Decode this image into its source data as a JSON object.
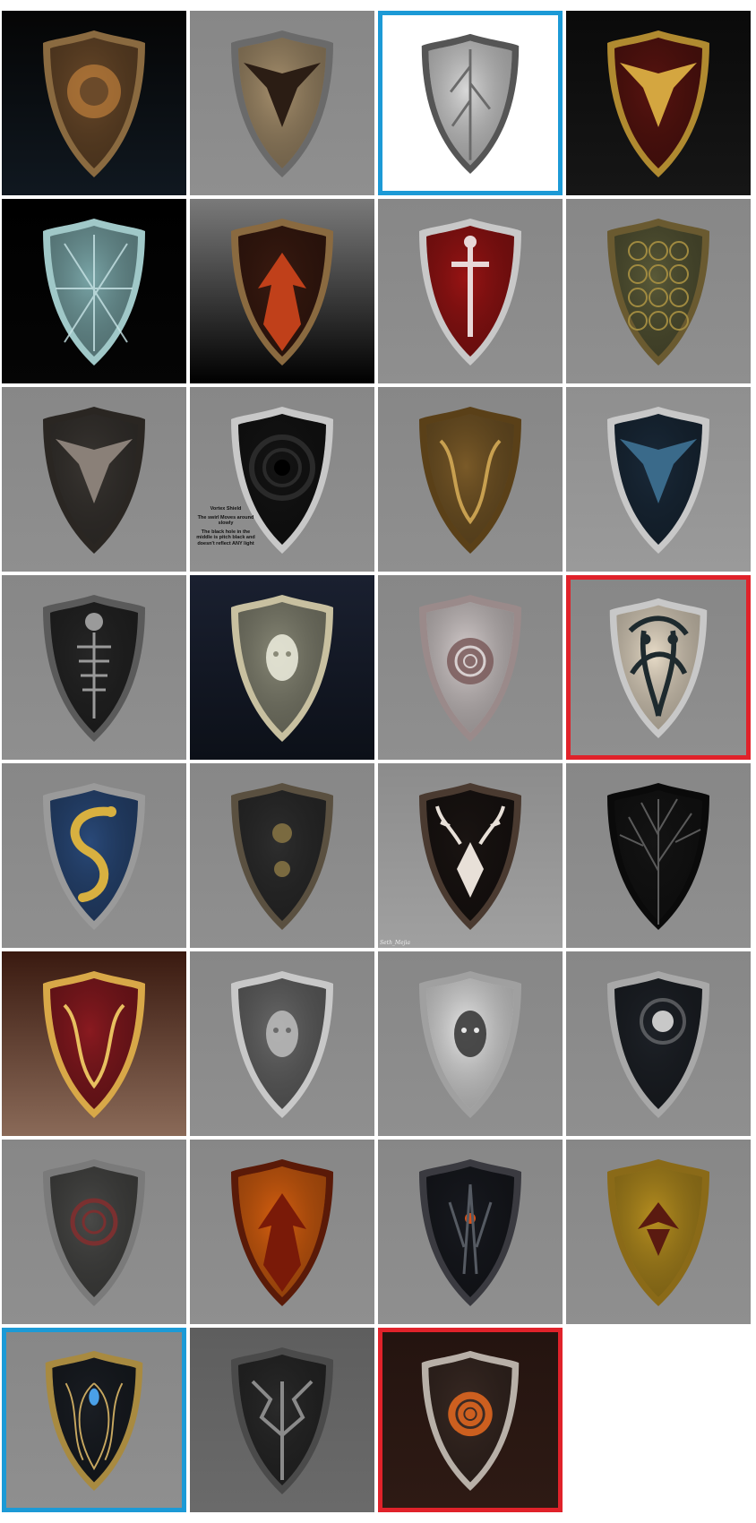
{
  "grid": {
    "tiles": [
      {
        "name": "lion-shield",
        "bg": "#050505",
        "bg2": "#101820",
        "face": "#6b4a2a",
        "accent": "#d08a40",
        "rim": "#8a6a40",
        "motif": "lion-icon",
        "selected": null
      },
      {
        "name": "dragon-sigil-shield",
        "bg": "#878787",
        "bg2": "#8f8f8f",
        "face": "#a8916e",
        "accent": "#2b1d14",
        "rim": "#6a6a6a",
        "motif": "dragon-icon",
        "selected": null
      },
      {
        "name": "white-feather-shield",
        "bg": "#ffffff",
        "bg2": "#ffffff",
        "face": "#d8d8d8",
        "accent": "#6a6a6a",
        "rim": "#555555",
        "motif": "feather-icon",
        "selected": "blue"
      },
      {
        "name": "golden-dragon-shield",
        "bg": "#0a0a0a",
        "bg2": "#161616",
        "face": "#5a1410",
        "accent": "#d4a640",
        "rim": "#b08a30",
        "motif": "dragon-icon",
        "selected": null
      },
      {
        "name": "frost-shield",
        "bg": "#000000",
        "bg2": "#050505",
        "face": "#7aa6a8",
        "accent": "#c8e4e6",
        "rim": "#a0c8c8",
        "motif": "frost-icon",
        "selected": null
      },
      {
        "name": "fire-scale-shield",
        "bg": "#7a7a7a",
        "bg2": "#000000",
        "face": "#3a1a10",
        "accent": "#c0401a",
        "rim": "#8a6a40",
        "motif": "flame-icon",
        "selected": null
      },
      {
        "name": "red-sword-shield",
        "bg": "#878787",
        "bg2": "#8f8f8f",
        "face": "#9a1414",
        "accent": "#e8d8d8",
        "rim": "#c8c8c8",
        "motif": "sword-icon",
        "selected": null
      },
      {
        "name": "turtle-shell-shield",
        "bg": "#878787",
        "bg2": "#8f8f8f",
        "face": "#5a5a38",
        "accent": "#a08a40",
        "rim": "#6a5a30",
        "motif": "scale-icon",
        "selected": null
      },
      {
        "name": "bird-mask-shield",
        "bg": "#878787",
        "bg2": "#8f8f8f",
        "face": "#3a3632",
        "accent": "#8a8078",
        "rim": "#2a2622",
        "motif": "bird-icon",
        "selected": null
      },
      {
        "name": "vortex-shield",
        "bg": "#878787",
        "bg2": "#8f8f8f",
        "face": "#141414",
        "accent": "#2a2a2a",
        "rim": "#c8c8c8",
        "motif": "vortex-icon",
        "selected": null,
        "caption_title": "Vortex Shield",
        "caption_lines": [
          "The swirl Moves around slowly",
          "The black hole in the middle is pitch black and doesn't reflect ANY light"
        ]
      },
      {
        "name": "bronze-ornate-shield",
        "bg": "#878787",
        "bg2": "#8f8f8f",
        "face": "#7a5a28",
        "accent": "#c8a050",
        "rim": "#5a4018",
        "motif": "ornament-icon",
        "selected": null
      },
      {
        "name": "raven-blue-shield",
        "bg": "#8f8f8f",
        "bg2": "#9a9a9a",
        "face": "#1a2a3a",
        "accent": "#3a6a8a",
        "rim": "#c8c8c8",
        "motif": "raven-icon",
        "selected": null
      },
      {
        "name": "skeleton-shield",
        "bg": "#878787",
        "bg2": "#8f8f8f",
        "face": "#262626",
        "accent": "#9a9a9a",
        "rim": "#5a5a5a",
        "motif": "skull-icon",
        "selected": null
      },
      {
        "name": "silver-face-shield",
        "bg": "#1a2030",
        "bg2": "#0c1018",
        "face": "#8a8a78",
        "accent": "#e8e8d8",
        "rim": "#c8c0a0",
        "motif": "face-icon",
        "selected": null
      },
      {
        "name": "white-rose-shield",
        "bg": "#878787",
        "bg2": "#8f8f8f",
        "face": "#d8d0d0",
        "accent": "#7a5a5a",
        "rim": "#9a8a8a",
        "motif": "rose-icon",
        "selected": null
      },
      {
        "name": "celtic-knot-shield",
        "bg": "#878787",
        "bg2": "#8f8f8f",
        "face": "#e8dcc8",
        "accent": "#1e2a2e",
        "rim": "#c8c8c8",
        "motif": "knot-icon",
        "selected": "red"
      },
      {
        "name": "golden-serpent-shield",
        "bg": "#878787",
        "bg2": "#8f8f8f",
        "face": "#2a4a7a",
        "accent": "#d8b040",
        "rim": "#9a9a9a",
        "motif": "serpent-icon",
        "selected": null
      },
      {
        "name": "twin-sun-shield",
        "bg": "#878787",
        "bg2": "#8f8f8f",
        "face": "#2e2e2e",
        "accent": "#7a6a40",
        "rim": "#5a5040",
        "motif": "sun-icon",
        "selected": null
      },
      {
        "name": "stag-shield",
        "bg": "#8c8c8c",
        "bg2": "#a0a0a0",
        "face": "#1a1412",
        "accent": "#e8e0d8",
        "rim": "#4a3a30",
        "motif": "stag-icon",
        "selected": null,
        "signature": "Seth_Mejia"
      },
      {
        "name": "dark-branches-shield",
        "bg": "#878787",
        "bg2": "#8f8f8f",
        "face": "#141414",
        "accent": "#5a5a5a",
        "rim": "#0a0a0a",
        "motif": "branch-icon",
        "selected": null
      },
      {
        "name": "crimson-gold-shield",
        "bg": "#3a1a10",
        "bg2": "#8a6a58",
        "face": "#8a1a20",
        "accent": "#e8c060",
        "rim": "#d8a848",
        "motif": "ornament-icon",
        "selected": null
      },
      {
        "name": "demon-face-shield",
        "bg": "#878787",
        "bg2": "#8f8f8f",
        "face": "#6a6a6a",
        "accent": "#b8b8b8",
        "rim": "#c8c8c8",
        "motif": "demon-icon",
        "selected": null
      },
      {
        "name": "maiden-shield",
        "bg": "#878787",
        "bg2": "#8f8f8f",
        "face": "#e8e8e8",
        "accent": "#3a3a3a",
        "rim": "#a0a0a0",
        "motif": "maiden-icon",
        "selected": null
      },
      {
        "name": "moon-orb-shield",
        "bg": "#878787",
        "bg2": "#8f8f8f",
        "face": "#1e2228",
        "accent": "#c8c8c8",
        "rim": "#a8a8a8",
        "motif": "orb-icon",
        "selected": null
      },
      {
        "name": "ash-ring-shield",
        "bg": "#878787",
        "bg2": "#8f8f8f",
        "face": "#4a4a48",
        "accent": "#7a3030",
        "rim": "#7a7a7a",
        "motif": "ring-icon",
        "selected": null
      },
      {
        "name": "flame-orange-shield",
        "bg": "#878787",
        "bg2": "#8f8f8f",
        "face": "#d86010",
        "accent": "#7a1a08",
        "rim": "#5a1a08",
        "motif": "flame-icon",
        "selected": null
      },
      {
        "name": "ember-core-shield",
        "bg": "#878787",
        "bg2": "#8f8f8f",
        "face": "#181a20",
        "accent": "#d85018",
        "rim": "#3a3a40",
        "motif": "ember-icon",
        "selected": null
      },
      {
        "name": "gold-leaf-shield",
        "bg": "#878787",
        "bg2": "#8f8f8f",
        "face": "#b89020",
        "accent": "#5a1a10",
        "rim": "#8a6a18",
        "motif": "leaf-icon",
        "selected": null
      },
      {
        "name": "sapphire-filigree-shield",
        "bg": "#878787",
        "bg2": "#8f8f8f",
        "face": "#1a1e24",
        "accent": "#c8a860",
        "rim": "#a88a40",
        "motif": "gem-icon",
        "selected": "blue"
      },
      {
        "name": "black-spikes-shield",
        "bg": "#5e5e5e",
        "bg2": "#6a6a6a",
        "face": "#2a2a2a",
        "accent": "#8a8a8a",
        "rim": "#4a4a4a",
        "motif": "spike-icon",
        "selected": null
      },
      {
        "name": "fire-rose-shield",
        "bg": "#241410",
        "bg2": "#2e1a14",
        "face": "#3a2a24",
        "accent": "#e86a20",
        "rim": "#b8b0a8",
        "motif": "rose-icon",
        "selected": "red"
      }
    ]
  }
}
